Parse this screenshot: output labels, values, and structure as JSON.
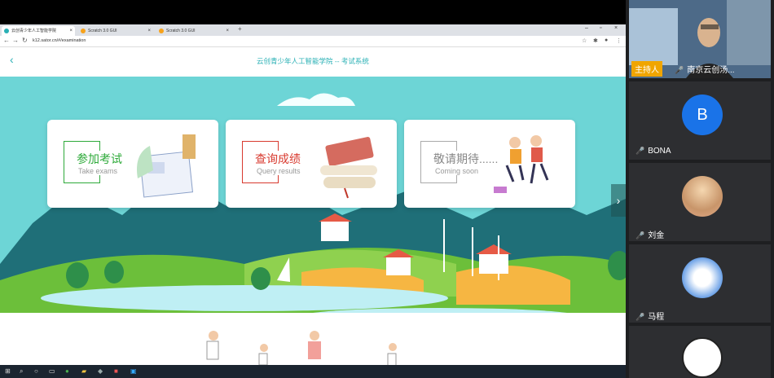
{
  "browser": {
    "tabs": [
      {
        "label": "云创青少年人工智能学院"
      },
      {
        "label": "Scratch 3.0 GUI"
      },
      {
        "label": "Scratch 3.0 GUI"
      }
    ],
    "url": "k12.sator.cn/#/examination"
  },
  "page": {
    "title": "云创青少年人工智能学院 -- 考试系统",
    "cards": [
      {
        "cn": "参加考试",
        "en": "Take exams",
        "color": "#2eaa3a"
      },
      {
        "cn": "查询成绩",
        "en": "Query results",
        "color": "#d83a2f"
      },
      {
        "cn": "敬请期待......",
        "en": "Coming soon",
        "color": "#aaaaaa"
      }
    ]
  },
  "meeting": {
    "host_badge": "主持人",
    "host_name": "南京云创汤...",
    "participants": [
      {
        "name": "BONA",
        "avatar_letter": "B"
      },
      {
        "name": "刘金",
        "avatar_letter": ""
      },
      {
        "name": "马程",
        "avatar_letter": ""
      },
      {
        "name": "",
        "avatar_letter": ""
      }
    ]
  },
  "colors": {
    "accent": "#2ab0b5",
    "sky": "#6dd5d6"
  }
}
